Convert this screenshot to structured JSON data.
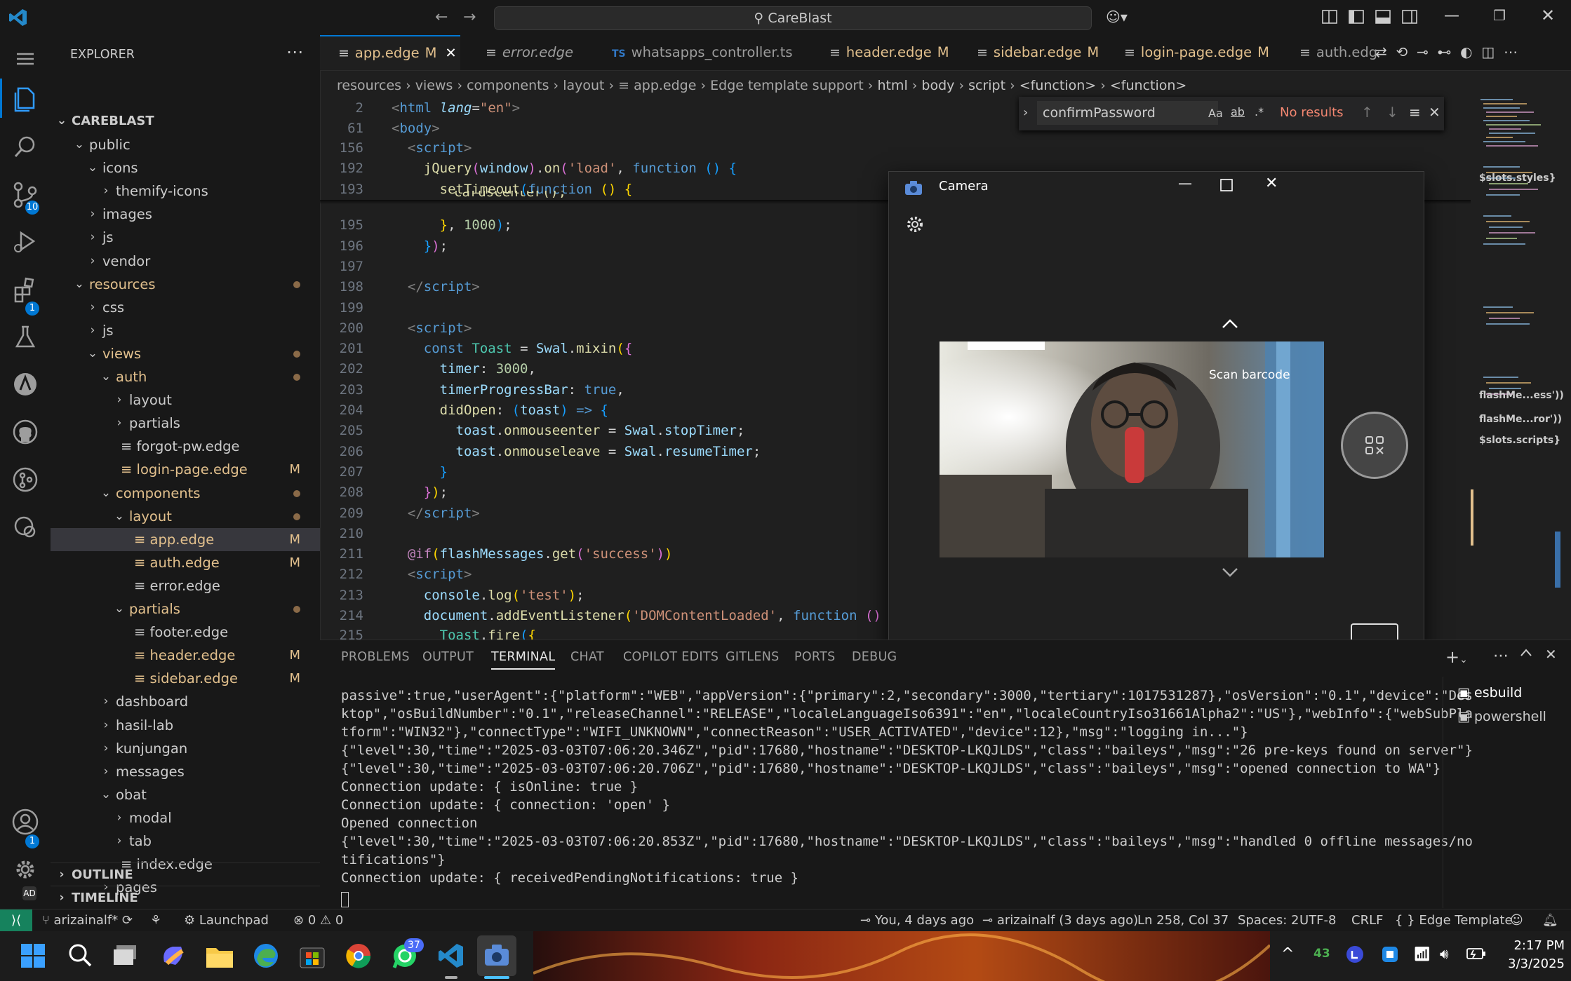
{
  "titlebar": {
    "search_text": "CareBlast"
  },
  "activity": {
    "scm_badge": "10",
    "ext_badge": "1",
    "accounts_badge": "1",
    "manage_badge": "AD"
  },
  "sidebar": {
    "title": "EXPLORER",
    "root": "CAREBLAST",
    "items": [
      {
        "label": "public",
        "depth": 1,
        "chev": "open"
      },
      {
        "label": "icons",
        "depth": 2,
        "chev": "open"
      },
      {
        "label": "themify-icons",
        "depth": 3,
        "chev": "closed"
      },
      {
        "label": "images",
        "depth": 2,
        "chev": "closed"
      },
      {
        "label": "js",
        "depth": 2,
        "chev": "closed"
      },
      {
        "label": "vendor",
        "depth": 2,
        "chev": "closed"
      },
      {
        "label": "resources",
        "depth": 1,
        "chev": "open",
        "status": "dot",
        "color": "mod"
      },
      {
        "label": "css",
        "depth": 2,
        "chev": "closed"
      },
      {
        "label": "js",
        "depth": 2,
        "chev": "closed"
      },
      {
        "label": "views",
        "depth": 2,
        "chev": "open",
        "status": "dot",
        "color": "mod"
      },
      {
        "label": "auth",
        "depth": 3,
        "chev": "open",
        "status": "dot",
        "color": "mod"
      },
      {
        "label": "layout",
        "depth": 4,
        "chev": "closed"
      },
      {
        "label": "partials",
        "depth": 4,
        "chev": "closed"
      },
      {
        "label": "forgot-pw.edge",
        "depth": 4,
        "file": true
      },
      {
        "label": "login-page.edge",
        "depth": 4,
        "file": true,
        "status": "M",
        "color": "mod"
      },
      {
        "label": "components",
        "depth": 3,
        "chev": "open",
        "status": "dot",
        "color": "mod"
      },
      {
        "label": "layout",
        "depth": 4,
        "chev": "open",
        "status": "dot",
        "color": "mod"
      },
      {
        "label": "app.edge",
        "depth": 5,
        "file": true,
        "status": "M",
        "color": "mod",
        "selected": true
      },
      {
        "label": "auth.edge",
        "depth": 5,
        "file": true,
        "status": "M",
        "color": "mod"
      },
      {
        "label": "error.edge",
        "depth": 5,
        "file": true
      },
      {
        "label": "partials",
        "depth": 4,
        "chev": "open",
        "status": "dot",
        "color": "mod"
      },
      {
        "label": "footer.edge",
        "depth": 5,
        "file": true
      },
      {
        "label": "header.edge",
        "depth": 5,
        "file": true,
        "status": "M",
        "color": "mod"
      },
      {
        "label": "sidebar.edge",
        "depth": 5,
        "file": true,
        "status": "M",
        "color": "mod"
      },
      {
        "label": "dashboard",
        "depth": 3,
        "chev": "closed"
      },
      {
        "label": "hasil-lab",
        "depth": 3,
        "chev": "closed"
      },
      {
        "label": "kunjungan",
        "depth": 3,
        "chev": "closed"
      },
      {
        "label": "messages",
        "depth": 3,
        "chev": "closed"
      },
      {
        "label": "obat",
        "depth": 3,
        "chev": "open"
      },
      {
        "label": "modal",
        "depth": 4,
        "chev": "closed"
      },
      {
        "label": "tab",
        "depth": 4,
        "chev": "closed"
      },
      {
        "label": "index.edge",
        "depth": 4,
        "file": true
      },
      {
        "label": "pages",
        "depth": 3,
        "chev": "closed"
      }
    ],
    "outline": "OUTLINE",
    "timeline": "TIMELINE"
  },
  "tabs": [
    {
      "icon": "≡",
      "label": "app.edge",
      "mark": "M",
      "active": true
    },
    {
      "icon": "≡",
      "label": "error.edge",
      "italic": true
    },
    {
      "icon": "TS",
      "label": "whatsapps_controller.ts"
    },
    {
      "icon": "≡",
      "label": "header.edge",
      "mark": "M"
    },
    {
      "icon": "≡",
      "label": "sidebar.edge",
      "mark": "M"
    },
    {
      "icon": "≡",
      "label": "login-page.edge",
      "mark": "M"
    },
    {
      "icon": "≡",
      "label": "auth.edg"
    }
  ],
  "breadcrumb": [
    "resources",
    "views",
    "components",
    "layout",
    "≡ app.edge",
    "Edge template support",
    "html",
    "body",
    "script",
    "<function>",
    "<function>"
  ],
  "find": {
    "query": "confirmPassword",
    "result": "No results"
  },
  "camera": {
    "title": "Camera",
    "tooltip": "Scan barcode"
  },
  "code_lines": [
    {
      "n": "2",
      "h": "<span class='gt'>&lt;</span><span class='tg'>html</span> <span class='at'>lang</span><span class='p'>=</span><span class='s'>\"en\"</span><span class='gt'>&gt;</span>"
    },
    {
      "n": "61",
      "h": "<span class='gt'>&lt;</span><span class='tg'>body</span><span class='gt'>&gt;</span>"
    },
    {
      "n": "156",
      "h": "  <span class='gt'>&lt;</span><span class='tg'>script</span><span class='gt'>&gt;</span>"
    },
    {
      "n": "192",
      "h": "    <span class='fn'>jQuery</span><span class='pk'>(</span><span class='v'>window</span><span class='pk'>)</span>.<span class='fn'>on</span><span class='pk'>(</span><span class='s'>'load'</span>, <span class='k'>function</span> <span class='bl'>()</span> <span class='bl'>{</span>"
    },
    {
      "n": "193",
      "h": "      <span class='fn'>setTimeout</span><span class='bl'>(</span><span class='k'>function</span> <span class='y'>()</span> <span class='y'>{</span>"
    },
    {
      "n": "195",
      "h": "      <span class='y'>}</span>, <span class='n'>1000</span><span class='bl'>)</span>;"
    },
    {
      "n": "196",
      "h": "    <span class='bl'>}</span><span class='pk'>)</span>;"
    },
    {
      "n": "197",
      "h": ""
    },
    {
      "n": "198",
      "h": "  <span class='gt'>&lt;/</span><span class='tg'>script</span><span class='gt'>&gt;</span>"
    },
    {
      "n": "199",
      "h": ""
    },
    {
      "n": "200",
      "h": "  <span class='gt'>&lt;</span><span class='tg'>script</span><span class='gt'>&gt;</span>"
    },
    {
      "n": "201",
      "h": "    <span class='k'>const</span> <span class='ty'>Toast</span> = <span class='v'>Swal</span>.<span class='fn'>mixin</span><span class='y'>(</span><span class='pk'>{</span>"
    },
    {
      "n": "202",
      "h": "      <span class='v'>timer</span>: <span class='n'>3000</span>,"
    },
    {
      "n": "203",
      "h": "      <span class='v'>timerProgressBar</span>: <span class='k'>true</span>,"
    },
    {
      "n": "204",
      "h": "      <span class='fn'>didOpen</span>: <span class='bl'>(</span><span class='v'>toast</span><span class='bl'>)</span> <span class='k'>=&gt;</span> <span class='bl'>{</span>"
    },
    {
      "n": "205",
      "h": "        <span class='v'>toast</span>.<span class='fn'>onmouseenter</span> = <span class='v'>Swal</span>.<span class='v'>stopTimer</span>;"
    },
    {
      "n": "206",
      "h": "        <span class='v'>toast</span>.<span class='fn'>onmouseleave</span> = <span class='v'>Swal</span>.<span class='v'>resumeTimer</span>;"
    },
    {
      "n": "207",
      "h": "      <span class='bl'>}</span>"
    },
    {
      "n": "208",
      "h": "    <span class='pk'>}</span><span class='y'>)</span>;"
    },
    {
      "n": "209",
      "h": "  <span class='gt'>&lt;/</span><span class='tg'>script</span><span class='gt'>&gt;</span>"
    },
    {
      "n": "210",
      "h": ""
    },
    {
      "n": "211",
      "h": "  <span class='kw'>@if</span><span class='y'>(</span><span class='v'>flashMessages</span>.<span class='fn'>get</span><span class='pk'>(</span><span class='s'>'success'</span><span class='pk'>)</span><span class='y'>)</span>"
    },
    {
      "n": "212",
      "h": "  <span class='gt'>&lt;</span><span class='tg'>script</span><span class='gt'>&gt;</span>"
    },
    {
      "n": "213",
      "h": "    <span class='v'>console</span>.<span class='fn'>log</span><span class='y'>(</span><span class='s'>'test'</span><span class='y'>)</span>;"
    },
    {
      "n": "214",
      "h": "    <span class='v'>document</span>.<span class='fn'>addEventListener</span><span class='y'>(</span><span class='s'>'DOMContentLoaded'</span>, <span class='k'>function</span> <span class='pk'>()</span>"
    },
    {
      "n": "215",
      "h": "      <span class='ty'>Toast</span>.<span class='fn'>fire</span><span class='bl'>(</span><span class='y'>{</span>"
    }
  ],
  "panel": {
    "tabs": [
      "PROBLEMS",
      "OUTPUT",
      "TERMINAL",
      "CHAT",
      "COPILOT EDITS",
      "GITLENS",
      "PORTS",
      "DEBUG"
    ],
    "active_tab": "TERMINAL",
    "terminals": [
      "esbuild",
      "powershell"
    ],
    "lines": [
      "passive\":true,\"userAgent\":{\"platform\":\"WEB\",\"appVersion\":{\"primary\":2,\"secondary\":3000,\"tertiary\":1017531287},\"osVersion\":\"0.1\",\"device\":\"Des",
      "ktop\",\"osBuildNumber\":\"0.1\",\"releaseChannel\":\"RELEASE\",\"localeLanguageIso6391\":\"en\",\"localeCountryIso31661Alpha2\":\"US\"},\"webInfo\":{\"webSubPla",
      "tform\":\"WIN32\"},\"connectType\":\"WIFI_UNKNOWN\",\"connectReason\":\"USER_ACTIVATED\",\"device\":12},\"msg\":\"logging in...\"}",
      "{\"level\":30,\"time\":\"2025-03-03T07:06:20.346Z\",\"pid\":17680,\"hostname\":\"DESKTOP-LKQJLDS\",\"class\":\"baileys\",\"msg\":\"26 pre-keys found on server\"}",
      "{\"level\":30,\"time\":\"2025-03-03T07:06:20.706Z\",\"pid\":17680,\"hostname\":\"DESKTOP-LKQJLDS\",\"class\":\"baileys\",\"msg\":\"opened connection to WA\"}",
      "Connection update: { isOnline: true }",
      "Connection update: { connection: 'open' }",
      "Opened connection",
      "{\"level\":30,\"time\":\"2025-03-03T07:06:20.853Z\",\"pid\":17680,\"hostname\":\"DESKTOP-LKQJLDS\",\"class\":\"baileys\",\"msg\":\"handled 0 offline messages/no",
      "tifications\"}",
      "Connection update: { receivedPendingNotifications: true }"
    ]
  },
  "minimap_labels": [
    "$slots.styles}",
    "flashMe...ess'))",
    "flashMe...ror'))",
    "$slots.scripts}"
  ],
  "status": {
    "branch": "arizainalf*",
    "launchpad": "Launchpad",
    "errors": "0",
    "warnings": "0",
    "blame": "You, 4 days ago",
    "author": "arizainalf (3 days ago)",
    "position": "Ln 258, Col 37",
    "spaces": "Spaces: 2",
    "encoding": "UTF-8",
    "eol": "CRLF",
    "language": "Edge Template"
  },
  "taskbar": {
    "whatsapp_badge": "37",
    "tray_number": "43",
    "time": "2:17 PM",
    "date": "3/3/2025"
  }
}
